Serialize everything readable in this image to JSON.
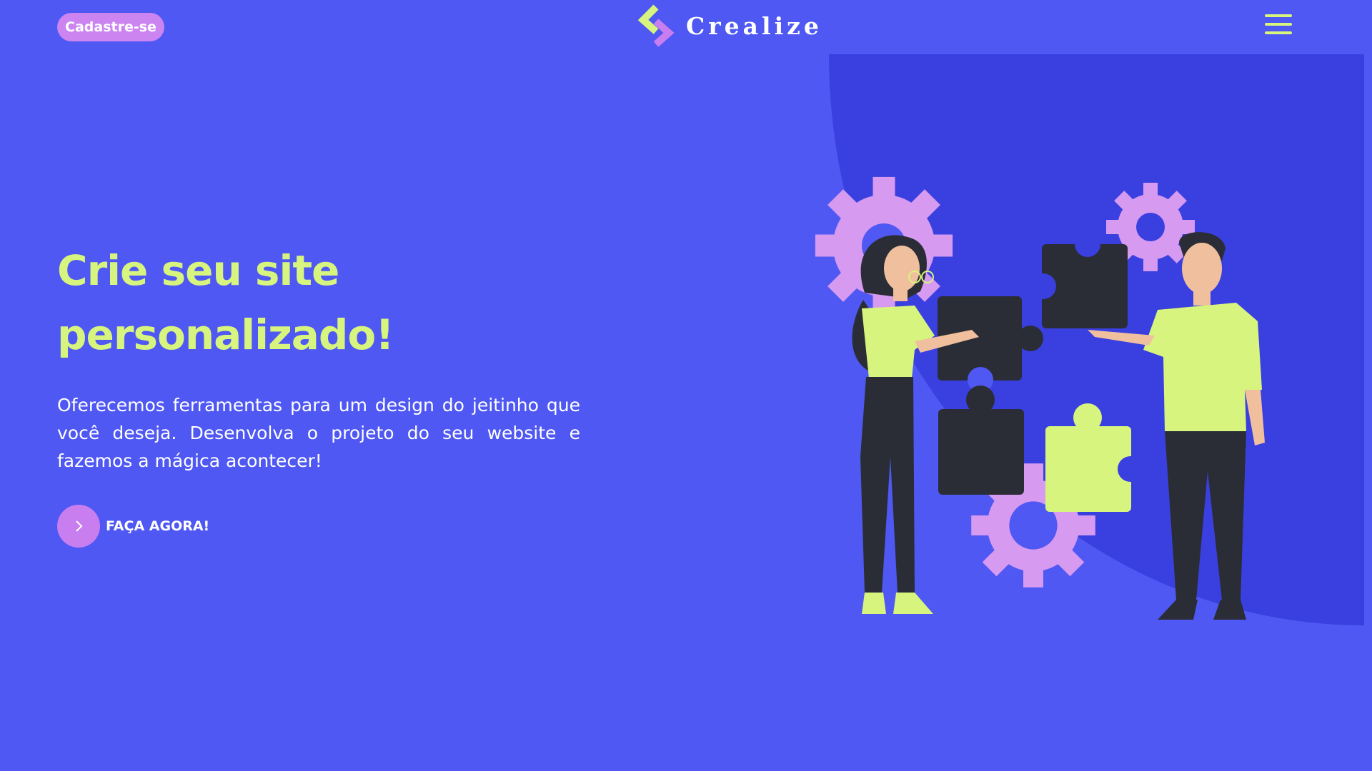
{
  "header": {
    "signup_label": "Cadastre-se",
    "brand_name": "Crealize",
    "menu_icon": "hamburger-menu-icon"
  },
  "hero": {
    "title_line1": "Crie seu site",
    "title_line2": "personalizado!",
    "description": "Oferecemos ferramentas para um design do jeitinho que você deseja. Desenvolva o projeto do seu website e fazemos a mágica acontecer!",
    "cta_label": "FAÇA AGORA!",
    "cta_icon": "chevron-right-icon"
  },
  "illustration": {
    "name": "two-people-assembling-puzzle-illustration"
  },
  "colors": {
    "background": "#4f58f2",
    "accent_lime": "#d7f57e",
    "accent_purple": "#cb84f0",
    "blob": "#3a40df",
    "puzzle_dark": "#2a2d35",
    "scrollbar_thumb": "#7a1fe0"
  }
}
